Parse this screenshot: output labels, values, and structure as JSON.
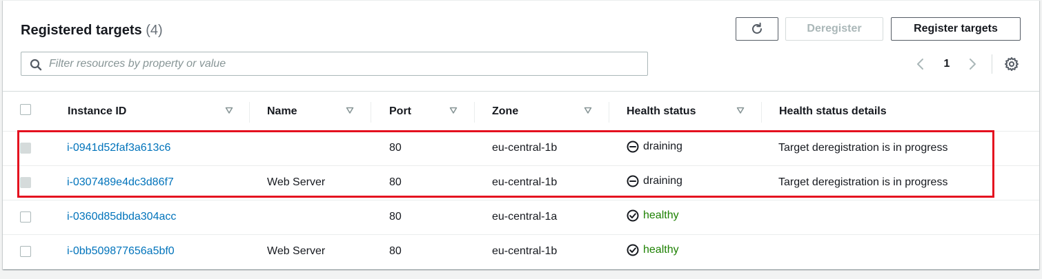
{
  "header": {
    "title": "Registered targets",
    "count": "(4)",
    "refresh_icon": "refresh-icon",
    "deregister_label": "Deregister",
    "register_label": "Register targets"
  },
  "filter": {
    "placeholder": "Filter resources by property or value",
    "value": "",
    "icon": "search-icon"
  },
  "pagination": {
    "current_page": "1",
    "prev_icon": "chevron-left-icon",
    "next_icon": "chevron-right-icon",
    "settings_icon": "gear-icon"
  },
  "table": {
    "columns": [
      "Instance ID",
      "Name",
      "Port",
      "Zone",
      "Health status",
      "Health status details"
    ],
    "rows": [
      {
        "instance_id": "i-0941d52faf3a613c6",
        "name": "",
        "port": "80",
        "zone": "eu-central-1b",
        "health_status": "draining",
        "health_icon": "minus-circle-icon",
        "details": "Target deregistration is in progress",
        "selectable": false
      },
      {
        "instance_id": "i-0307489e4dc3d86f7",
        "name": "Web Server",
        "port": "80",
        "zone": "eu-central-1b",
        "health_status": "draining",
        "health_icon": "minus-circle-icon",
        "details": "Target deregistration is in progress",
        "selectable": false
      },
      {
        "instance_id": "i-0360d85dbda304acc",
        "name": "",
        "port": "80",
        "zone": "eu-central-1a",
        "health_status": "healthy",
        "health_icon": "check-circle-icon",
        "details": "",
        "selectable": true
      },
      {
        "instance_id": "i-0bb509877656a5bf0",
        "name": "Web Server",
        "port": "80",
        "zone": "eu-central-1b",
        "health_status": "healthy",
        "health_icon": "check-circle-icon",
        "details": "",
        "selectable": true
      }
    ]
  },
  "colors": {
    "link": "#0073bb",
    "healthy": "#1d8102",
    "highlight": "#e4101f"
  }
}
